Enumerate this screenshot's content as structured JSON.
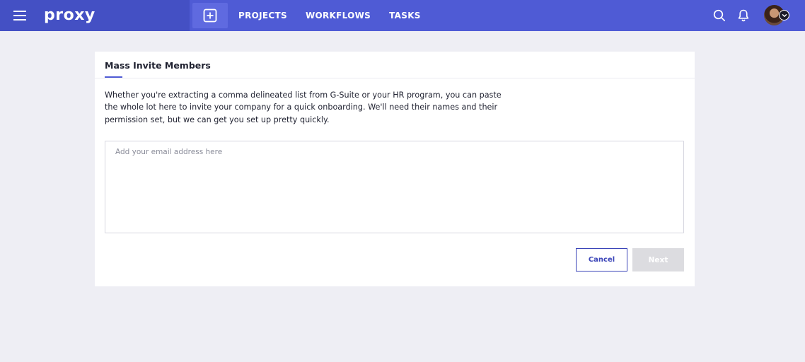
{
  "header": {
    "logo_text": "proxy",
    "nav": [
      {
        "label": "PROJECTS"
      },
      {
        "label": "WORKFLOWS"
      },
      {
        "label": "TASKS"
      }
    ],
    "icons": {
      "menu": "hamburger-menu-icon",
      "add": "plus-square-icon",
      "search": "search-icon",
      "notifications": "bell-icon",
      "avatar_caret": "chevron-down-icon"
    },
    "colors": {
      "bar": "#4f5bd5",
      "brand_area": "#4450c4",
      "accent": "#3a44b8"
    }
  },
  "card": {
    "tab_label": "Mass Invite Members",
    "description": "Whether you're extracting a comma delineated list from G-Suite or your HR program, you can paste the whole lot here to invite your company for a quick onboarding. We'll need their names and their permission set, but we can get you set up pretty quickly.",
    "email_input": {
      "placeholder": "Add your email address here",
      "value": ""
    },
    "buttons": {
      "cancel": "Cancel",
      "next": "Next"
    }
  }
}
